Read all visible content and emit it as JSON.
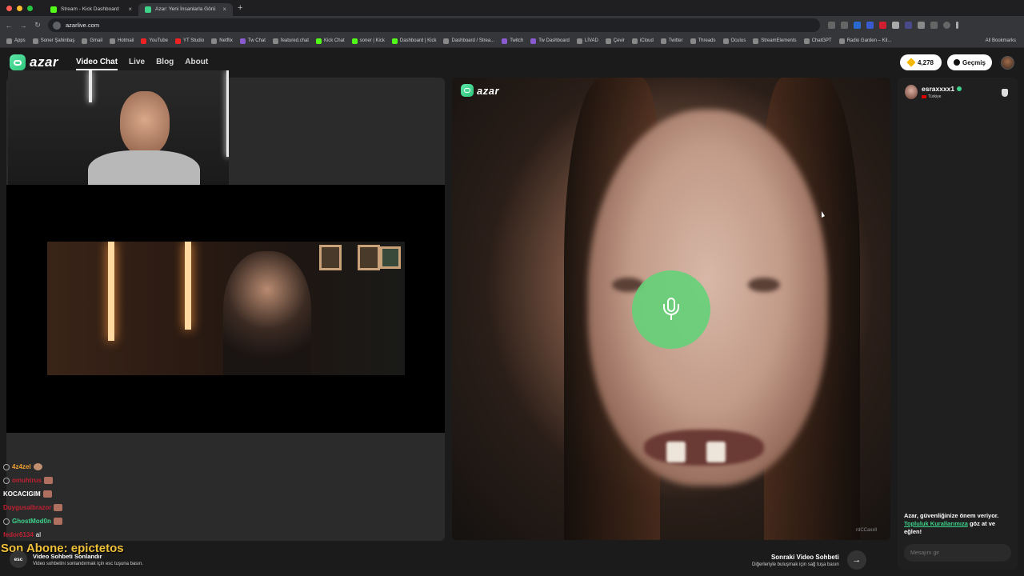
{
  "browser": {
    "tabs": [
      {
        "label": "Stream - Kick Dashboard",
        "active": false,
        "color": "#53fc18"
      },
      {
        "label": "Azar: Yeni İnsanlarla Görü",
        "active": true,
        "color": "#3ed38a"
      }
    ],
    "url": "azarlive.com",
    "bookmarks": [
      "Apps",
      "Soner Şahinbaş",
      "Gmail",
      "Hotmail",
      "YouTube",
      "YT Studio",
      "Netflix",
      "Tw Chat",
      "featured.chat",
      "Kick Chat",
      "soner | Kick",
      "Dashboard | Kick",
      "Dashboard / Strea...",
      "Twitch",
      "Tw Dashboard",
      "LİVAD",
      "Çevir",
      "iCloud",
      "Twitter",
      "Threads",
      "Oculus",
      "StreamElements",
      "ChatGPT",
      "Radio Garden – Kil..."
    ],
    "all_bookmarks": "All Bookmarks"
  },
  "header": {
    "logo": "azar",
    "nav": [
      {
        "label": "Video Chat",
        "active": true
      },
      {
        "label": "Live",
        "active": false
      },
      {
        "label": "Blog",
        "active": false
      },
      {
        "label": "About",
        "active": false
      }
    ],
    "gems": "4,278",
    "history": "Geçmiş"
  },
  "stream_overlay": {
    "chat": [
      {
        "user": "4z4zel",
        "msg": "",
        "color": "#f0a030"
      },
      {
        "user": "omuhtrus",
        "msg": "",
        "color": "#c02030"
      },
      {
        "user": "KOCACIGIM",
        "msg": "",
        "color": "#ffffff"
      },
      {
        "user": "Duygusalbrazor",
        "msg": "",
        "color": "#c02030"
      },
      {
        "user": "GhostMod0n",
        "msg": "",
        "color": "#3ed38a"
      },
      {
        "user": "fedor6134",
        "msg": "al",
        "color": "#c02030"
      }
    ],
    "sub_banner": "Son Abone: epictetos"
  },
  "controls": {
    "esc_key": "esc",
    "end_title": "Video Sohbeti Sonlandır",
    "end_sub": "Video sohbetini sonlandırmak için esc tuşuna basın.",
    "next_title": "Sonraki Video Sohbeti",
    "next_sub": "Diğerleriyle buluşmak için sağ tuşa basın"
  },
  "main_video": {
    "logo": "azar",
    "watermark": "rdCCaxxll",
    "mic_color": "#64d278"
  },
  "sidebar": {
    "partner_name": "esraxxxx1",
    "partner_country": "Türkiye",
    "safety_prefix": "Azar, güvenliğinize önem veriyor. ",
    "safety_link": "Topluluk Kurallarımıza",
    "safety_suffix": " göz at ve eğlen!",
    "message_placeholder": "Mesajını gir"
  }
}
